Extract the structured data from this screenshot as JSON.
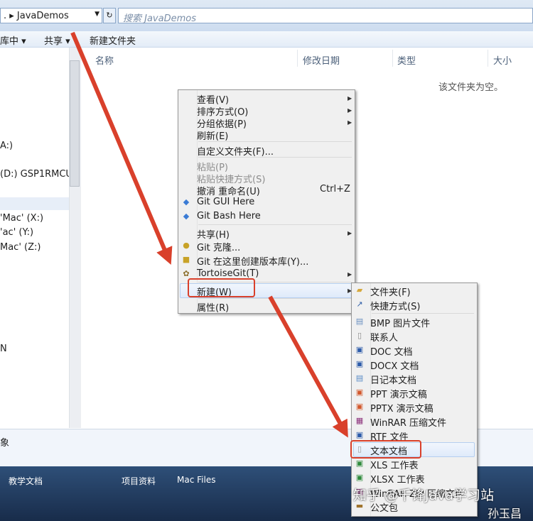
{
  "address": {
    "path": ". ▸ JavaDemos",
    "search_placeholder": "搜索 JavaDemos"
  },
  "toolbar": {
    "library": "库中",
    "share": "共享",
    "new_folder": "新建文件夹"
  },
  "nav": {
    "items": [
      "A:)",
      "(D:) GSP1RMCUL",
      "'Mac' (X:)",
      "'ac' (Y:)",
      "Mac' (Z:)",
      "N"
    ]
  },
  "columns": {
    "name": "名称",
    "date": "修改日期",
    "type": "类型",
    "size": "大小"
  },
  "empty_message": "该文件夹为空。",
  "status": {
    "text": "象"
  },
  "taskbar": {
    "items": [
      "教学文档",
      "项目资料",
      "Mac Files"
    ]
  },
  "context_menu": {
    "view": "查看(V)",
    "sort": "排序方式(O)",
    "group": "分组依据(P)",
    "refresh": "刷新(E)",
    "customize": "自定义文件夹(F)...",
    "paste": "粘贴(P)",
    "paste_shortcut": "粘贴快捷方式(S)",
    "undo": "撤消 重命名(U)",
    "undo_shortcut": "Ctrl+Z",
    "git_gui": "Git GUI Here",
    "git_bash": "Git Bash Here",
    "share": "共享(H)",
    "git_clone": "Git 克隆...",
    "git_create": "Git 在这里创建版本库(Y)...",
    "tortoise": "TortoiseGit(T)",
    "new": "新建(W)",
    "properties": "属性(R)"
  },
  "submenu": {
    "folder": "文件夹(F)",
    "shortcut": "快捷方式(S)",
    "bmp": "BMP 图片文件",
    "contact": "联系人",
    "doc": "DOC 文档",
    "docx": "DOCX 文档",
    "journal": "日记本文档",
    "ppt": "PPT 演示文稿",
    "pptx": "PPTX 演示文稿",
    "winrar": "WinRAR 压缩文件",
    "rtf": "RTF 文件",
    "text": "文本文档",
    "xls": "XLS 工作表",
    "xlsx": "XLSX 工作表",
    "winrar_zip": "WinRAR ZIP 压缩文件",
    "briefcase": "公文包"
  },
  "watermark": {
    "line1": "知乎 @千锋Java学习站",
    "line2": "孙玉昌"
  },
  "colors": {
    "arrow": "#d9402b",
    "highlight_border": "#b5cff0",
    "menu_bg": "#f0f0f0"
  }
}
